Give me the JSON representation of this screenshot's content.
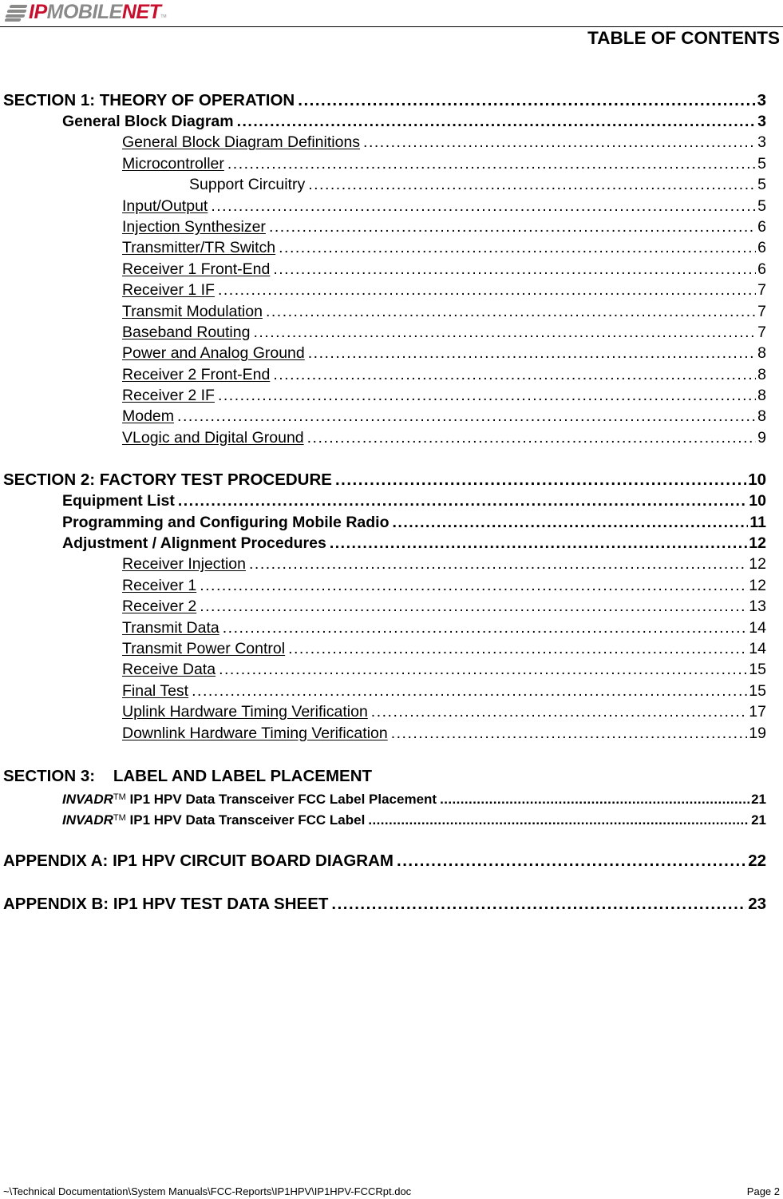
{
  "header": {
    "logo": {
      "part1": "IP",
      "part2": "Mobile",
      "part3": "Net",
      "trademark": "TM"
    },
    "title": "TABLE OF CONTENTS"
  },
  "toc": {
    "section1": {
      "title": "SECTION 1:  THEORY OF OPERATION",
      "page": "3",
      "entries": [
        {
          "level": 1,
          "title": "General Block Diagram",
          "page": "3"
        },
        {
          "level": 2,
          "title": "General Block Diagram Definitions",
          "page": "3"
        },
        {
          "level": 2,
          "title": "Microcontroller",
          "page": "5"
        },
        {
          "level": 3,
          "title": "Support Circuitry",
          "page": "5"
        },
        {
          "level": 2,
          "title": "Input/Output",
          "page": "5"
        },
        {
          "level": 2,
          "title": "Injection Synthesizer",
          "page": "6"
        },
        {
          "level": 2,
          "title": "Transmitter/TR Switch",
          "page": "6"
        },
        {
          "level": 2,
          "title": "Receiver 1 Front-End",
          "page": "6"
        },
        {
          "level": 2,
          "title": "Receiver 1 IF",
          "page": "7"
        },
        {
          "level": 2,
          "title": "Transmit Modulation",
          "page": "7"
        },
        {
          "level": 2,
          "title": "Baseband Routing",
          "page": "7"
        },
        {
          "level": 2,
          "title": "Power and Analog Ground",
          "page": "8"
        },
        {
          "level": 2,
          "title": "Receiver 2 Front-End",
          "page": "8"
        },
        {
          "level": 2,
          "title": "Receiver 2 IF",
          "page": "8"
        },
        {
          "level": 2,
          "title": "Modem",
          "page": "8"
        },
        {
          "level": 2,
          "title": "VLogic and Digital Ground",
          "page": "9"
        }
      ]
    },
    "section2": {
      "title": "SECTION 2:  FACTORY TEST PROCEDURE",
      "page": "10",
      "entries": [
        {
          "level": 1,
          "title": "Equipment List",
          "page": "10"
        },
        {
          "level": 1,
          "title": "Programming and Configuring Mobile Radio",
          "page": "11"
        },
        {
          "level": 1,
          "title": "Adjustment / Alignment Procedures",
          "page": "12"
        },
        {
          "level": 2,
          "title": "Receiver Injection",
          "page": "12"
        },
        {
          "level": 2,
          "title": "Receiver 1",
          "page": "12"
        },
        {
          "level": 2,
          "title": "Receiver 2",
          "page": "13"
        },
        {
          "level": 2,
          "title": "Transmit Data",
          "page": "14"
        },
        {
          "level": 2,
          "title": "Transmit Power Control",
          "page": "14"
        },
        {
          "level": 2,
          "title": "Receive Data",
          "page": "15"
        },
        {
          "level": 2,
          "title": "Final Test",
          "page": "15"
        },
        {
          "level": 2,
          "title": "Uplink Hardware Timing Verification",
          "page": "17"
        },
        {
          "level": 2,
          "title": "Downlink Hardware Timing Verification",
          "page": "19"
        }
      ]
    },
    "section3": {
      "title": "SECTION 3:    LABEL AND LABEL PLACEMENT",
      "entries": [
        {
          "brand": "INVADR",
          "tm": "TM",
          "title": " IP1 HPV Data Transceiver FCC Label Placement",
          "page": "21"
        },
        {
          "brand": "INVADR",
          "tm": "TM",
          "title": " IP1 HPV Data Transceiver FCC Label",
          "page": "21"
        }
      ]
    },
    "appendixA": {
      "title": "APPENDIX A:  IP1 HPV CIRCUIT BOARD DIAGRAM",
      "page": "22"
    },
    "appendixB": {
      "title": "APPENDIX B:  IP1 HPV TEST DATA SHEET",
      "page": "23"
    }
  },
  "footer": {
    "path": "~\\Technical Documentation\\System Manuals\\FCC-Reports\\IP1HPV\\IP1HPV-FCCRpt.doc",
    "page": "Page 2"
  }
}
